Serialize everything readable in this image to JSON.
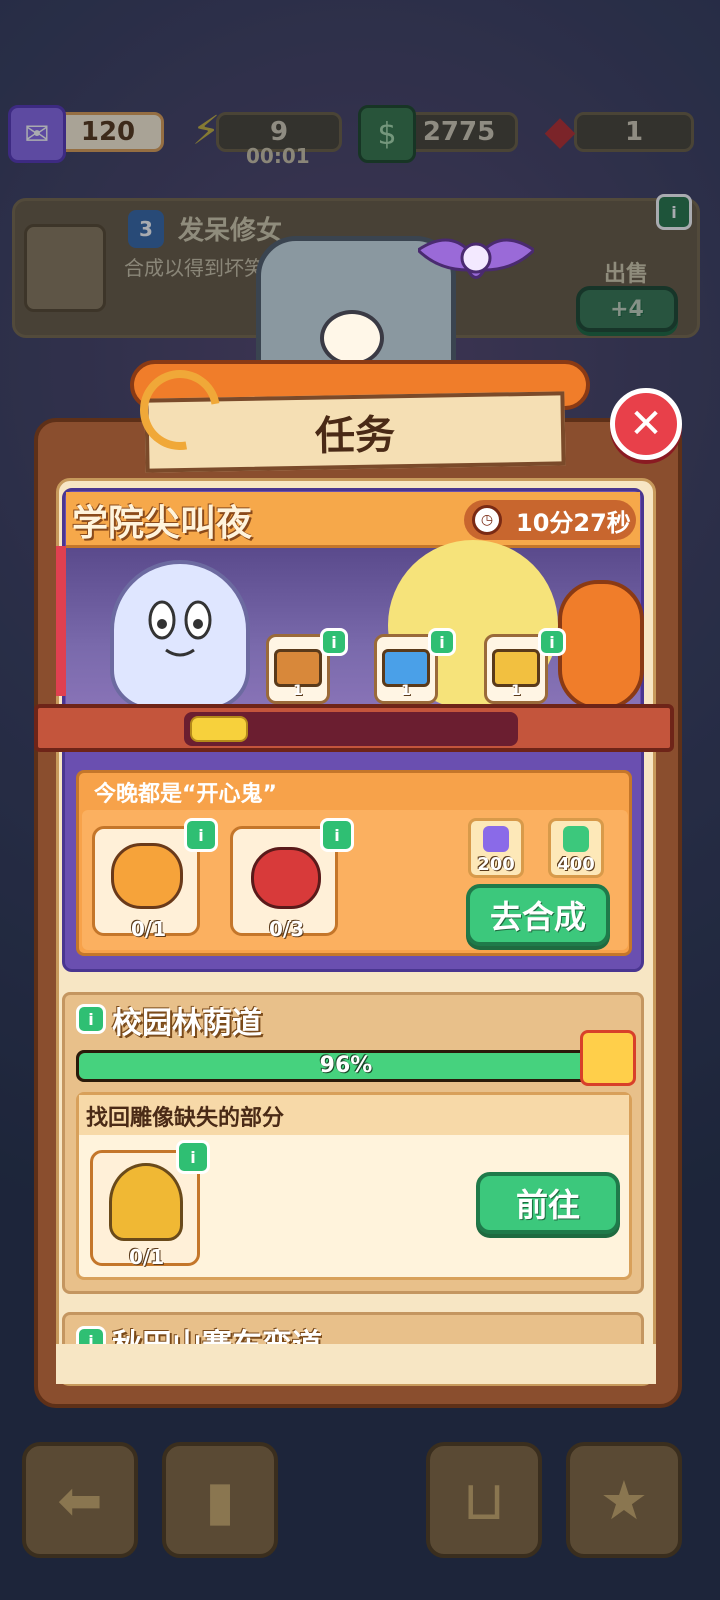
{
  "resources": {
    "tickets": "120",
    "energy": "9",
    "energy_timer": "00:01",
    "cash": "2775",
    "gems": "1"
  },
  "order": {
    "level": "3",
    "name": "发呆修女",
    "description": "合成以得到坏笑狼人",
    "sell_label": "出售",
    "sell_value": "+4",
    "info_label": "i"
  },
  "panel": {
    "title": "任务",
    "close_icon": "✕"
  },
  "event": {
    "title": "学院尖叫夜",
    "timer": "10分27秒",
    "progress_fraction": 0.18,
    "chests": [
      {
        "name": "wooden-chest",
        "count": "1",
        "color": "#d8883a"
      },
      {
        "name": "blue-chest",
        "count": "1",
        "color": "#4aa0e8"
      },
      {
        "name": "gold-chest",
        "count": "1",
        "color": "#f2c040"
      }
    ],
    "quest": {
      "title": "今晚都是“开心鬼”",
      "items": [
        {
          "name": "pudding-ghost",
          "count": "0/1"
        },
        {
          "name": "red-devil",
          "count": "0/3"
        }
      ],
      "rewards": [
        {
          "name": "ticket-icon",
          "value": "200"
        },
        {
          "name": "cash-icon",
          "value": "400"
        }
      ],
      "button": "去合成"
    }
  },
  "section2": {
    "title": "校园林荫道",
    "progress_percent": 96,
    "progress_label": "96%",
    "task_title": "找回雕像缺失的部分",
    "item_count": "0/1",
    "button": "前往"
  },
  "section3": {
    "title": "秋田山赛车弯道"
  },
  "colors": {
    "accent_green": "#3cc87c",
    "accent_orange": "#f7a24a",
    "panel_brown": "#8a4e2e"
  }
}
